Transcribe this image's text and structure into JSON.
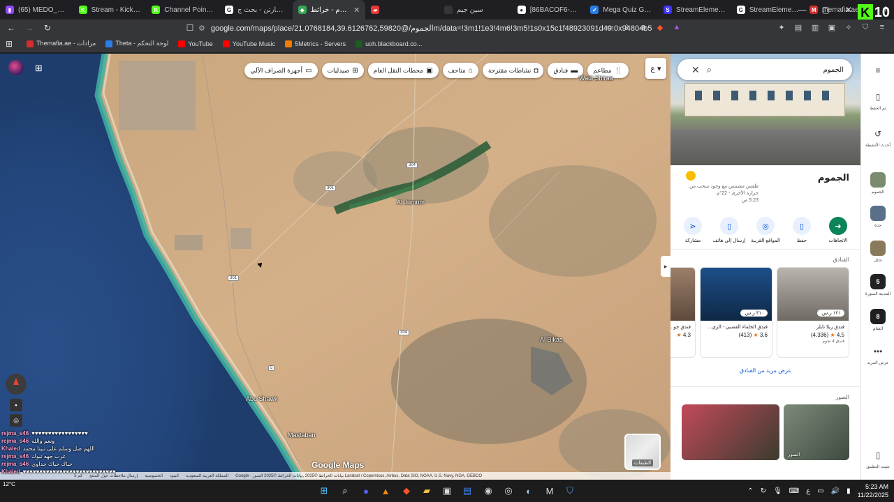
{
  "tabs": [
    {
      "label": "(65) MEDO_DV - Tw",
      "icon": "twitch-icon",
      "color": "#9146ff",
      "glyph": "▮"
    },
    {
      "label": "Stream - Kick Da",
      "icon": "kick-icon",
      "color": "#53fc18",
      "glyph": "K"
    },
    {
      "label": "Channel Points - Ki",
      "icon": "kick-icon",
      "color": "#53fc18",
      "glyph": "K"
    },
    {
      "label": "سانت مارتن - بحث ج",
      "icon": "google-icon",
      "color": "#ffffff",
      "glyph": "G"
    },
    {
      "label": "الجموم - خرائط",
      "icon": "maps-icon",
      "color": "#34a853",
      "glyph": "◆",
      "active": true
    },
    {
      "label": "",
      "icon": "pinned-icon",
      "color": "#e53935",
      "glyph": "▰"
    },
    {
      "label": "سين جيم",
      "icon": "blank-icon",
      "color": "#35363a",
      "glyph": ""
    },
    {
      "label": "[86BACOF6-F697-4...",
      "icon": "github-icon",
      "color": "#ffffff",
      "glyph": "●"
    },
    {
      "label": "Mega Quiz Gaming",
      "icon": "quiz-icon",
      "color": "#2b7de9",
      "glyph": "✔"
    },
    {
      "label": "StreamElements - C",
      "icon": "streamelements-icon",
      "color": "#3f33ff",
      "glyph": "S"
    },
    {
      "label": "StreamElements SE",
      "icon": "google-icon",
      "color": "#ffffff",
      "glyph": "G"
    },
    {
      "label": "themafia.ae - شارعي",
      "icon": "mafia-icon",
      "color": "#d32f2f",
      "glyph": "M"
    }
  ],
  "kick_count": "10",
  "url": "google.com/maps/place/الجموم/@21.0768184,39.6126762,59820m/data=!3m1!1e3!4m6!3m5!1s0x15c1f48923091d49:0x94804b55...",
  "bookmarks": [
    {
      "label": "Themafia.ae - مزادات",
      "color": "#d32f2f"
    },
    {
      "label": "Theta - لوحة التحكم",
      "color": "#2b7de9"
    },
    {
      "label": "YouTube",
      "color": "#ff0000"
    },
    {
      "label": "YouTube Music",
      "color": "#ff0000"
    },
    {
      "label": "5Metrics - Servers",
      "color": "#f57c00"
    },
    {
      "label": "uoh.blackboard.co...",
      "color": "#1b5e20"
    }
  ],
  "map": {
    "chips": [
      {
        "label": "مطاعم",
        "icon": "restaurant-icon",
        "glyph": "🍴"
      },
      {
        "label": "فنادق",
        "icon": "hotel-icon",
        "glyph": "▬"
      },
      {
        "label": "نشاطات مقترحة",
        "icon": "camera-icon",
        "glyph": "◘"
      },
      {
        "label": "متاحف",
        "icon": "museum-icon",
        "glyph": "⌂"
      },
      {
        "label": "محطات النقل العام",
        "icon": "transit-icon",
        "glyph": "▣"
      },
      {
        "label": "صيدليات",
        "icon": "pharmacy-icon",
        "glyph": "⊞"
      },
      {
        "label": "أجهزة الصراف الآلي",
        "icon": "atm-icon",
        "glyph": "▭"
      }
    ],
    "labels": {
      "al_jumum": "Al Jumum",
      "al_bikas": "Al Bikas",
      "abu_shawk": "Abu Shawk",
      "mastaban": "Mastaban",
      "wadi_shirah": "Wadi Shiraa"
    },
    "road_numbers": [
      "301",
      "304",
      "301",
      "5"
    ],
    "google_logo": "Google Maps",
    "layers_label": "الطبقات",
    "attribution": "Google - بيانات الخرائط ©2025 ,بيانات الخرائط ©2025 الصور Landsat / Copernicus, Airbus, Data SIO, NOAA, U.S. Navy, NGA, GEBCO",
    "attrib_links": [
      "المملكة العربية السعودية",
      "البنود",
      "الخصوصية",
      "إرسال ملاحظات حول المنتج",
      "5 كم"
    ]
  },
  "chat": [
    {
      "user": "rejma_s46",
      "text": "♥♥♥♥♥♥♥♥♥♥♥♥♥♥♥♥♥"
    },
    {
      "user": "rejma_s46",
      "text": "ونعم والله"
    },
    {
      "user": "Khaled",
      "text": "اللهم صل وسلم على نبينا محمد"
    },
    {
      "user": "rejma_s46",
      "text": "غرب جهه تبوك"
    },
    {
      "user": "rejma_s46",
      "text": "حياك حياك جداوي"
    },
    {
      "user": "Khaled",
      "text": "♥♥♥♥♥♥♥♥♥♥♥♥♥♥♥♥♥♥♥♥♥♥♥♥♥♥♥♥"
    }
  ],
  "panel": {
    "search_query": "الجموم",
    "place_title": "الجموم",
    "weather": {
      "line1": "طقس مشمس مع وجود سحب من",
      "line2": "حرارة الأخرى - ‎22‎°م",
      "line3": "5:23 ص"
    },
    "actions": [
      {
        "label": "الاتجاهات",
        "icon": "directions-icon",
        "glyph": "➜",
        "primary": true
      },
      {
        "label": "حفظ",
        "icon": "bookmark-icon",
        "glyph": "▯"
      },
      {
        "label": "المواقع القريبة",
        "icon": "nearby-icon",
        "glyph": "◎"
      },
      {
        "label": "إرسال إلى هاتف",
        "icon": "phone-icon",
        "glyph": "▯"
      },
      {
        "label": "مشاركة",
        "icon": "share-icon",
        "glyph": "⋖"
      }
    ],
    "hotels_title": "الفنادق",
    "hotels": [
      {
        "name": "فندق ريلا تايلر",
        "price": "١٢١ ر.س.",
        "rating": "4.5",
        "reviews": "(4,336)",
        "stars": "فندق 4 نجوم",
        "c1": "#b9b4ad",
        "c2": "#6f6a63"
      },
      {
        "name": "فندق الخلفاء القصبي - الزي...",
        "price": "٣١٠ ر.س.",
        "rating": "3.6",
        "reviews": "(413)",
        "stars": "",
        "c1": "#1d4f8a",
        "c2": "#0e2846"
      },
      {
        "name": "فندق جو...",
        "price": "",
        "rating": "4.3",
        "reviews": "",
        "stars": "",
        "c1": "#9b7f6a",
        "c2": "#5e4a3c"
      }
    ],
    "more_hotels": "عرض مزيد من الفنادق",
    "photos_title": "الصور",
    "photos": [
      {
        "caption": "الصور",
        "c1": "#7d8a7a",
        "c2": "#3f4a3f"
      },
      {
        "caption": "",
        "c1": "#c24a5a",
        "c2": "#3b3b2f"
      }
    ]
  },
  "rail": [
    {
      "label": "تم الحفظ",
      "icon": "saved-icon",
      "glyph": "▯",
      "type": "icon"
    },
    {
      "label": "أحدث الأنشطة",
      "icon": "history-icon",
      "glyph": "↺",
      "type": "icon"
    },
    {
      "label": "الجموم",
      "icon": "recent-place-thumb",
      "glyph": "",
      "color": "#7c8a6e",
      "type": "thumb"
    },
    {
      "label": "جدة",
      "icon": "recent-place-thumb",
      "glyph": "",
      "color": "#5a6f8a",
      "type": "thumb"
    },
    {
      "label": "حائل",
      "icon": "recent-place-thumb",
      "glyph": "",
      "color": "#8a7a5c",
      "type": "thumb"
    },
    {
      "label": "المدينة المنورة",
      "icon": "recent-place-thumb",
      "glyph": "5",
      "color": "#222222",
      "type": "thumb"
    },
    {
      "label": "الشام",
      "icon": "recent-place-thumb",
      "glyph": "8",
      "color": "#1f1f1f",
      "type": "thumb"
    },
    {
      "label": "عرض المزيد",
      "icon": "more-icon",
      "glyph": "•••",
      "type": "icon"
    },
    {
      "label": "تثبيت التطبيق",
      "icon": "install-app-icon",
      "glyph": "▯",
      "type": "icon"
    }
  ],
  "taskbar": {
    "weather": "12°C",
    "time": "5:23 AM",
    "date": "11/22/2025",
    "lang": "ع"
  }
}
